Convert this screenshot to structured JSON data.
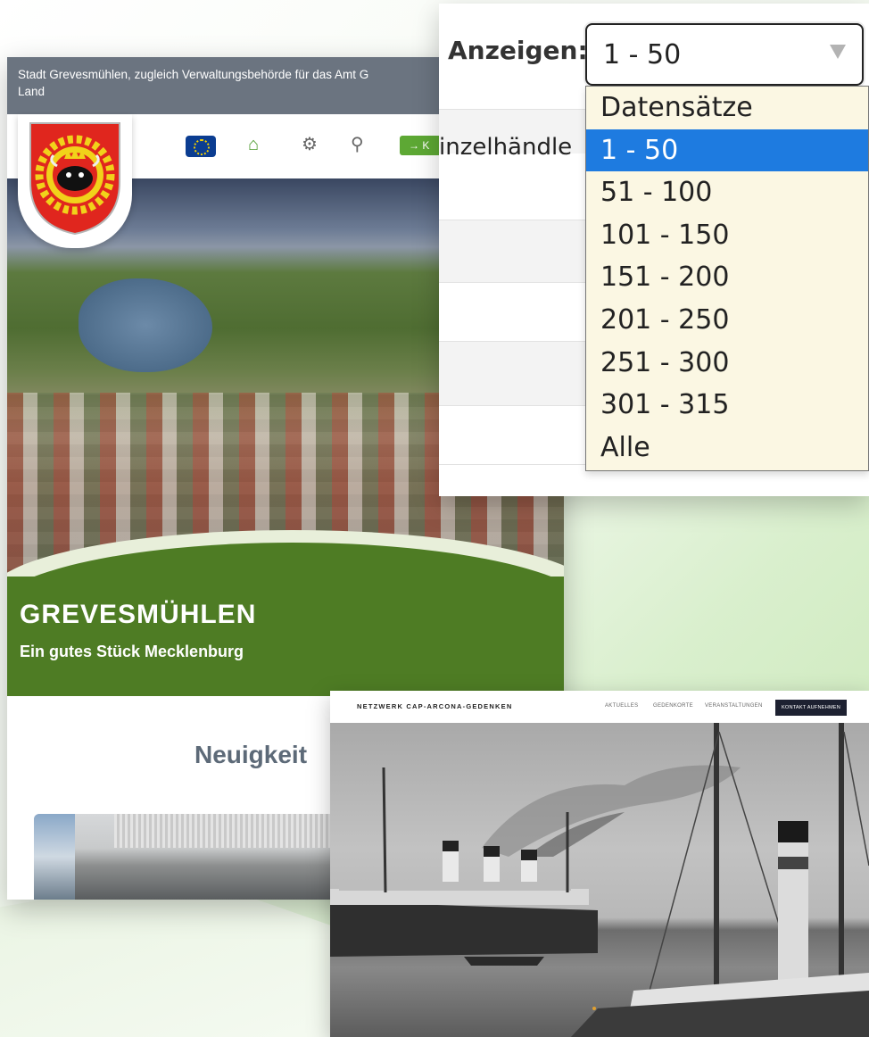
{
  "grevesmuehlen_site": {
    "topbar_text": "Stadt Grevesmühlen, zugleich Verwaltungsbehörde für das Amt G… Land",
    "topbar_line1": "Stadt Grevesmühlen, zugleich Verwaltungsbehörde für das Amt G",
    "topbar_line2": "Land",
    "login_label": "→ K",
    "title": "GREVESMÜHLEN",
    "subtitle": "Ein gutes Stück Mecklenburg",
    "news_heading": "Neuigkeit"
  },
  "dropdown_panel": {
    "label": "Anzeigen:",
    "selected_value": "1 - 50",
    "background_text": "inzelhändle",
    "options": [
      {
        "label": "Datensätze",
        "selected": false
      },
      {
        "label": "1 - 50",
        "selected": true
      },
      {
        "label": "51 - 100",
        "selected": false
      },
      {
        "label": "101 - 150",
        "selected": false
      },
      {
        "label": "151 - 200",
        "selected": false
      },
      {
        "label": "201 - 250",
        "selected": false
      },
      {
        "label": "251 - 300",
        "selected": false
      },
      {
        "label": "301 - 315",
        "selected": false
      },
      {
        "label": "Alle",
        "selected": false
      }
    ],
    "highlight_color": "#1e7be0"
  },
  "cap_arcona_site": {
    "brand": "NETZWERK CAP-ARCONA-GEDENKEN",
    "menu": [
      "AKTUELLES",
      "GEDENKORTE",
      "VERANSTALTUNGEN"
    ],
    "cta": "KONTAKT AUFNEHMEN"
  },
  "colors": {
    "brand_green": "#4e7c24",
    "topbar_gray": "#6b7480",
    "dropdown_bg": "#fbf7e3",
    "cta_dark": "#1d2131"
  }
}
